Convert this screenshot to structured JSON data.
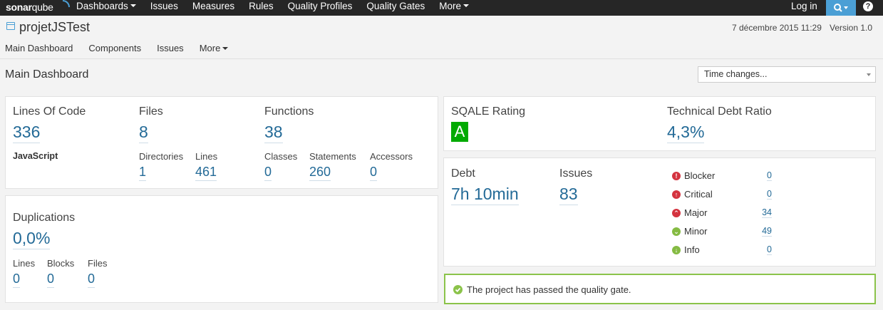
{
  "brand": {
    "name_bold": "sonar",
    "name_rest": "qube"
  },
  "topnav": {
    "items": [
      "Dashboards",
      "Issues",
      "Measures",
      "Rules",
      "Quality Profiles",
      "Quality Gates",
      "More"
    ],
    "login": "Log in",
    "help": "?"
  },
  "project": {
    "name": "projetJSTest",
    "date": "7 décembre 2015 11:29",
    "version": "Version 1.0",
    "subnav": [
      "Main Dashboard",
      "Components",
      "Issues",
      "More"
    ]
  },
  "page": {
    "title": "Main Dashboard",
    "time_select": "Time changes..."
  },
  "size": {
    "loc_label": "Lines Of Code",
    "loc_value": "336",
    "language": "JavaScript",
    "files_label": "Files",
    "files_value": "8",
    "directories_label": "Directories",
    "directories_value": "1",
    "lines_label": "Lines",
    "lines_value": "461",
    "functions_label": "Functions",
    "functions_value": "38",
    "classes_label": "Classes",
    "classes_value": "0",
    "statements_label": "Statements",
    "statements_value": "260",
    "accessors_label": "Accessors",
    "accessors_value": "0"
  },
  "duplications": {
    "label": "Duplications",
    "value": "0,0%",
    "lines_label": "Lines",
    "lines_value": "0",
    "blocks_label": "Blocks",
    "blocks_value": "0",
    "files_label": "Files",
    "files_value": "0"
  },
  "sqale": {
    "rating_label": "SQALE Rating",
    "rating_value": "A",
    "rating_color": "#00aa00",
    "tdr_label": "Technical Debt Ratio",
    "tdr_value": "4,3%"
  },
  "issues": {
    "debt_label": "Debt",
    "debt_value": "7h 10min",
    "issues_label": "Issues",
    "issues_value": "83",
    "severities": [
      {
        "label": "Blocker",
        "count": "0",
        "icon": "!",
        "color": "#d4333f"
      },
      {
        "label": "Critical",
        "count": "0",
        "icon": "↑",
        "color": "#d4333f"
      },
      {
        "label": "Major",
        "count": "34",
        "icon": "⌃",
        "color": "#d4333f"
      },
      {
        "label": "Minor",
        "count": "49",
        "icon": "⌄",
        "color": "#85bb43"
      },
      {
        "label": "Info",
        "count": "0",
        "icon": "↓",
        "color": "#85bb43"
      }
    ]
  },
  "quality_gate": {
    "message": "The project has passed the quality gate.",
    "color": "#8bc34a"
  }
}
